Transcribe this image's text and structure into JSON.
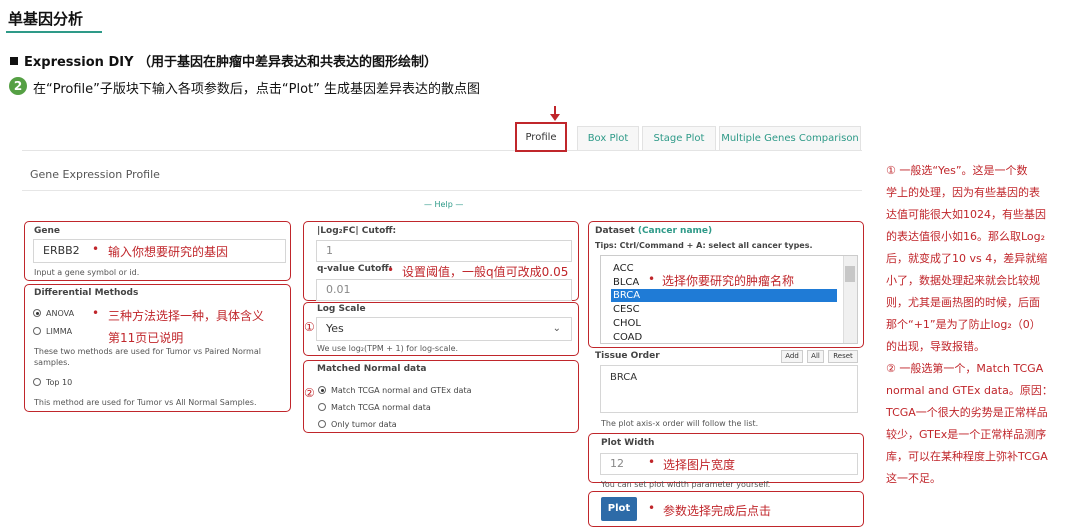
{
  "header": {
    "title": "单基因分析",
    "section": "Expression DIY （用于基因在肿瘤中差异表达和共表达的图形绘制）",
    "step_number": "2",
    "step_text": "在“Profile”子版块下输入各项参数后，点击“Plot” 生成基因差异表达的散点图"
  },
  "tabs": [
    "Profile",
    "Box Plot",
    "Stage Plot",
    "Multiple Genes Comparison"
  ],
  "panel": {
    "title": "Gene Expression Profile",
    "help": "— Help —"
  },
  "gene": {
    "label": "Gene",
    "value": "ERBB2",
    "hint": "Input a gene symbol or id.",
    "annotation": "输入你想要研究的基因"
  },
  "methods": {
    "label": "Differential Methods",
    "opt1": "ANOVA",
    "opt2": "LIMMA",
    "desc1": "These two methods are used for Tumor vs Paired Normal samples.",
    "opt3": "Top 10",
    "desc2": "This method are used for Tumor vs All Normal Samples.",
    "annotation_1": "三种方法选择一种，具体含义",
    "annotation_2": "第11页已说明"
  },
  "cutoff": {
    "label": "|Log₂FC| Cutoff:",
    "value": "1",
    "q_label": "q-value Cutoff:",
    "q_value": "0.01",
    "annotation": "设置阈值，一般q值可改成0.05"
  },
  "log_scale": {
    "label": "Log Scale",
    "value": "Yes",
    "hint": "We use log₂(TPM + 1) for log-scale.",
    "marker": "①"
  },
  "matched": {
    "label": "Matched Normal data",
    "opt1": "Match TCGA normal and GTEx data",
    "opt2": "Match TCGA normal data",
    "opt3": "Only tumor data",
    "marker": "②"
  },
  "dataset": {
    "label": "Dataset",
    "label_note": "(Cancer name)",
    "tips": "Tips: Ctrl/Command + A: select all cancer types.",
    "items": [
      "ACC",
      "BLCA",
      "BRCA",
      "CESC",
      "CHOL",
      "COAD"
    ],
    "selected": "BRCA",
    "annotation": "选择你要研究的肿瘤名称"
  },
  "tissue": {
    "label": "Tissue Order",
    "btn_add": "Add",
    "btn_all": "All",
    "btn_reset": "Reset",
    "value": "BRCA",
    "hint": "The plot axis-x order will follow the list."
  },
  "plot_width": {
    "label": "Plot Width",
    "value": "12",
    "hint": "You can set plot width parameter yourself.",
    "annotation": "选择图片宽度"
  },
  "plot_button": {
    "label": "Plot",
    "annotation": "参数选择完成后点击"
  },
  "side_note": {
    "lines": [
      "① 一般选“Yes”。这是一个数",
      "学上的处理，因为有些基因的表",
      "达值可能很大如1024，有些基因",
      "的表达值很小如16。那么取Log₂",
      "后，就变成了10 vs 4，差异就缩",
      "小了，数据处理起来就会比较规",
      "则，尤其是画热图的时候，后面",
      "那个“+1”是为了防止log₂（0）",
      "的出现，导致报错。",
      "② 一般选第一个，Match TCGA",
      "normal and GTEx data。原因：",
      "TCGA一个很大的劣势是正常样品",
      "较少，GTEx是一个正常样品测序",
      "库，可以在某种程度上弥补TCGA",
      "这一不足。"
    ]
  },
  "colors": {
    "accent_red": "#c0262b",
    "teal": "#2e9a88",
    "plot_blue": "#2d6ba8",
    "select_blue": "#1f7bd6"
  }
}
